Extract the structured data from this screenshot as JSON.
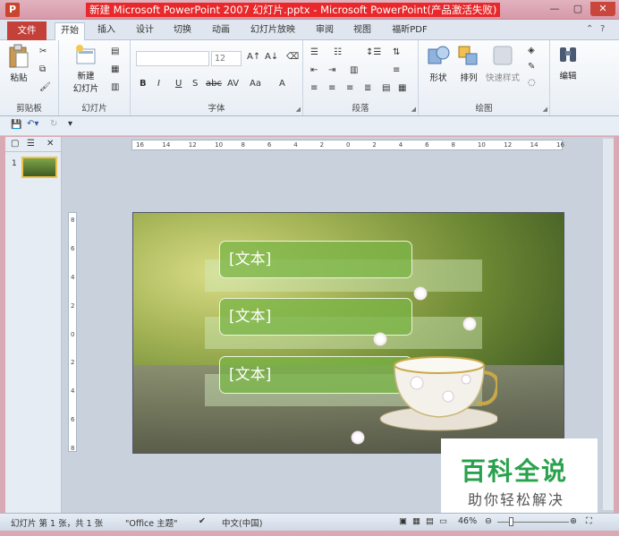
{
  "window": {
    "app_icon": "P",
    "title": "新建 Microsoft PowerPoint 2007 幻灯片.pptx - Microsoft PowerPoint(产品激活失败)",
    "controls": [
      "minimize-icon",
      "maximize-icon",
      "close-icon"
    ]
  },
  "tabs": {
    "file": "文件",
    "items": [
      "开始",
      "插入",
      "设计",
      "切换",
      "动画",
      "幻灯片放映",
      "审阅",
      "视图",
      "福昕PDF"
    ],
    "active": "开始"
  },
  "ribbon": {
    "clipboard": {
      "label": "剪贴板",
      "paste": "粘贴"
    },
    "slides": {
      "label": "幻灯片",
      "new_slide": "新建\n幻灯片"
    },
    "font": {
      "label": "字体",
      "font_name": "",
      "font_size": "12",
      "buttons": [
        "B",
        "I",
        "U",
        "S",
        "abc",
        "AV",
        "Aa",
        "A"
      ]
    },
    "paragraph": {
      "label": "段落"
    },
    "drawing": {
      "label": "绘图",
      "shape": "形状",
      "arrange": "排列",
      "quick_styles": "快速样式"
    },
    "editing": {
      "label": "编辑",
      "edit": "编辑"
    }
  },
  "ruler": {
    "h_ticks": [
      "16",
      "14",
      "12",
      "10",
      "8",
      "6",
      "4",
      "2",
      "0",
      "2",
      "4",
      "6",
      "8",
      "10",
      "12",
      "14",
      "16"
    ],
    "v_ticks": [
      "8",
      "6",
      "4",
      "2",
      "0",
      "2",
      "4",
      "6",
      "8"
    ]
  },
  "slides_pane": {
    "thumb_number": "1"
  },
  "slide": {
    "text_boxes": [
      "[文本]",
      "[文本]",
      "[文本]"
    ]
  },
  "watermark": {
    "main": "百科全说",
    "sub": "助你轻松解决"
  },
  "status": {
    "slide_info": "幻灯片 第 1 张，共 1 张",
    "theme": "\"Office 主题\"",
    "language": "中文(中国)",
    "zoom": "46%"
  },
  "colors": {
    "accent": "#c4413a",
    "title_highlight": "#e8282a",
    "watermark_green": "#2aa14c"
  }
}
